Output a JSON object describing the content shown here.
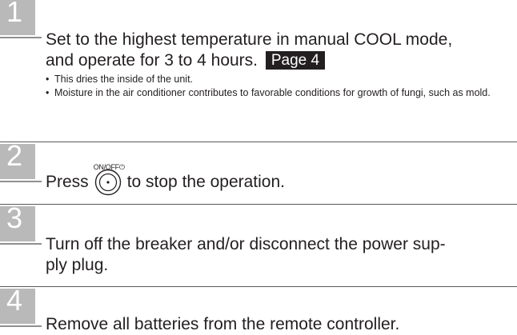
{
  "steps": [
    {
      "number": "1",
      "line1": "Set to the highest temperature in manual COOL mode,",
      "line2": "and operate for 3 to 4 hours.",
      "page_ref": "Page 4",
      "notes": [
        "This dries the inside of the unit.",
        "Moisture in the air conditioner contributes to favorable conditions for growth of fungi, such as mold."
      ]
    },
    {
      "number": "2",
      "text_before": "Press",
      "button_label": "ON/OFF⏻",
      "text_after": "to stop the operation."
    },
    {
      "number": "3",
      "line1": "Turn off the breaker and/or disconnect the power sup-",
      "line2": "ply plug."
    },
    {
      "number": "4",
      "line1": "Remove all batteries from the remote controller."
    }
  ]
}
